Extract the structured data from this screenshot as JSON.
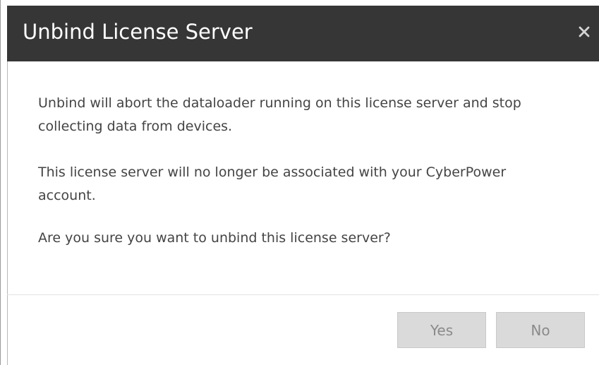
{
  "dialog": {
    "title": "Unbind License Server",
    "close_icon": "close-icon",
    "messages": [
      "Unbind will abort the dataloader running on this license server and stop collecting data from devices.",
      "This license server will no longer be associated with your CyberPower account.",
      "Are you sure you want to unbind this license server?"
    ],
    "buttons": {
      "yes_label": "Yes",
      "no_label": "No"
    }
  },
  "colors": {
    "titlebar_bg": "#363636",
    "title_text": "#ffffff",
    "body_text": "#444444",
    "button_bg": "#dadada",
    "button_text": "#8a8a8a"
  }
}
